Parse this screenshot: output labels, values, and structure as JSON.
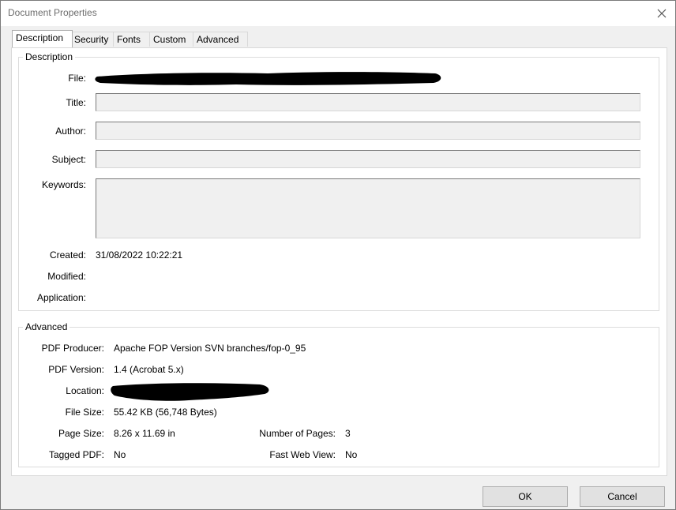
{
  "window": {
    "title": "Document Properties",
    "close_icon": "close-icon"
  },
  "tabs": [
    {
      "label": "Description",
      "active": true
    },
    {
      "label": "Security",
      "active": false
    },
    {
      "label": "Fonts",
      "active": false
    },
    {
      "label": "Custom",
      "active": false
    },
    {
      "label": "Advanced",
      "active": false
    }
  ],
  "description": {
    "group_title": "Description",
    "file": {
      "label": "File:",
      "value": ""
    },
    "title": {
      "label": "Title:",
      "value": ""
    },
    "author": {
      "label": "Author:",
      "value": ""
    },
    "subject": {
      "label": "Subject:",
      "value": ""
    },
    "keywords": {
      "label": "Keywords:",
      "value": ""
    },
    "created": {
      "label": "Created:",
      "value": "31/08/2022 10:22:21"
    },
    "modified": {
      "label": "Modified:",
      "value": ""
    },
    "application": {
      "label": "Application:",
      "value": ""
    }
  },
  "advanced": {
    "group_title": "Advanced",
    "pdf_producer": {
      "label": "PDF Producer:",
      "value": "Apache FOP Version SVN branches/fop-0_95"
    },
    "pdf_version": {
      "label": "PDF Version:",
      "value": "1.4 (Acrobat 5.x)"
    },
    "location": {
      "label": "Location:",
      "value": ""
    },
    "file_size": {
      "label": "File Size:",
      "value": "55.42 KB (56,748 Bytes)"
    },
    "page_size": {
      "label": "Page Size:",
      "value": "8.26 x 11.69 in"
    },
    "number_of_pages": {
      "label": "Number of Pages:",
      "value": "3"
    },
    "tagged_pdf": {
      "label": "Tagged PDF:",
      "value": "No"
    },
    "fast_web_view": {
      "label": "Fast Web View:",
      "value": "No"
    }
  },
  "buttons": {
    "ok": "OK",
    "cancel": "Cancel"
  }
}
